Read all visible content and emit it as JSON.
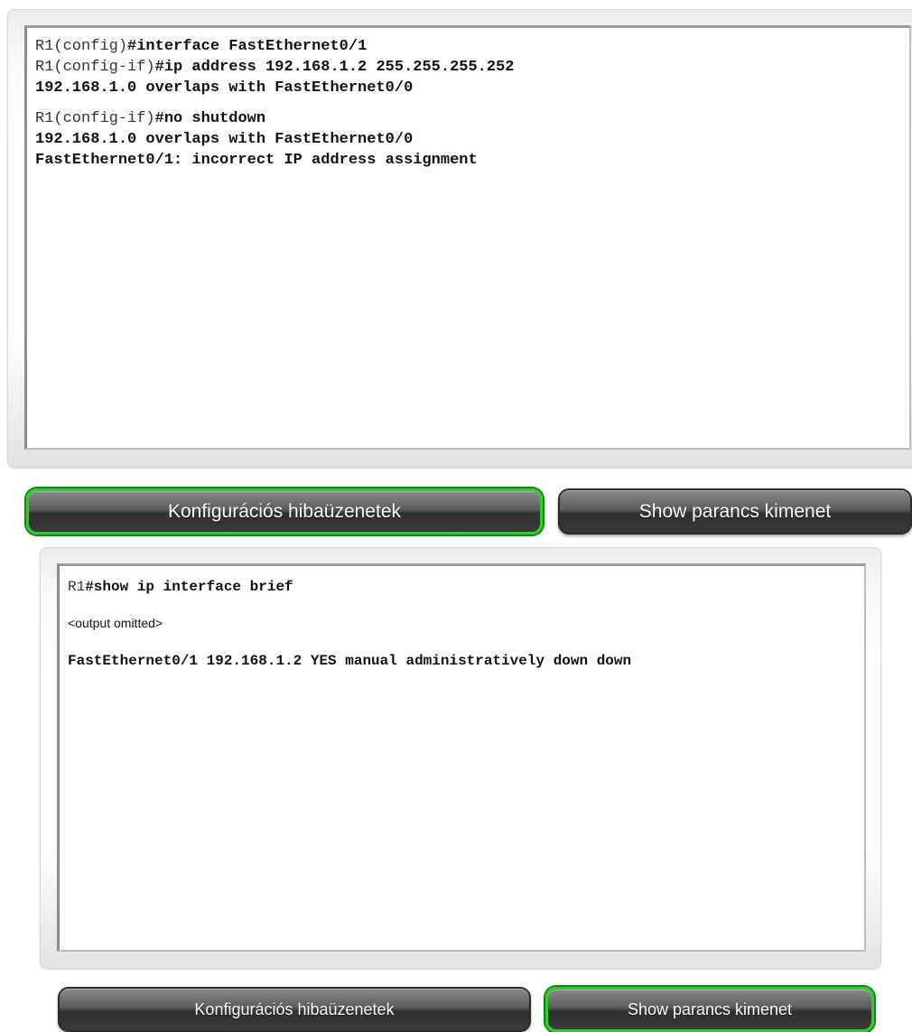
{
  "panel_top": {
    "console_lines": [
      {
        "prompt": "R1(config)",
        "command": "#interface FastEthernet0/1"
      },
      {
        "prompt": "R1(config-if)",
        "command": "#ip address 192.168.1.2 255.255.255.252"
      },
      {
        "message": "192.168.1.0 overlaps with FastEthernet0/0"
      },
      {
        "prompt": "R1(config-if)",
        "command": "#no shutdown"
      },
      {
        "message": "192.168.1.0 overlaps with FastEthernet0/0"
      },
      {
        "message": "FastEthernet0/1: incorrect IP address assignment"
      }
    ],
    "tabs": [
      {
        "label": "Konfigurációs hibaüzenetek",
        "active": true
      },
      {
        "label": "Show parancs kimenet",
        "active": false
      }
    ]
  },
  "panel_bottom": {
    "prompt": "R1",
    "command": "#show ip interface brief",
    "omitted": "<output omitted>",
    "result": "FastEthernet0/1 192.168.1.2 YES manual administratively down down",
    "tabs": [
      {
        "label": "Konfigurációs hibaüzenetek",
        "active": false
      },
      {
        "label": "Show parancs kimenet",
        "active": true
      }
    ]
  },
  "colors": {
    "active_tab_outline": "#2bd12b",
    "tab_background": "#4a4a4a"
  }
}
